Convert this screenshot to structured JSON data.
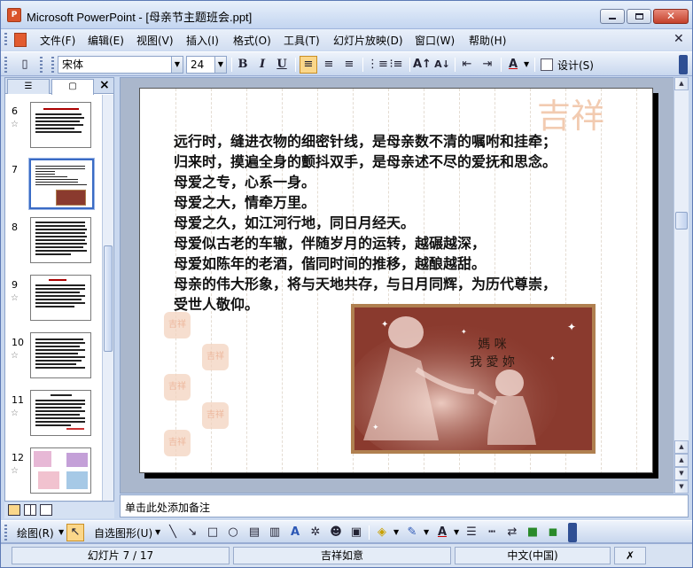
{
  "window": {
    "title": "Microsoft PowerPoint - [母亲节主题班会.ppt]",
    "app_icon": "P"
  },
  "menu": {
    "items": [
      "文件(F)",
      "编辑(E)",
      "视图(V)",
      "插入(I)",
      "格式(O)",
      "工具(T)",
      "幻灯片放映(D)",
      "窗口(W)",
      "帮助(H)"
    ]
  },
  "toolbar": {
    "font_name": "宋体",
    "font_size": "24",
    "bold": "B",
    "italic": "I",
    "underline": "U",
    "design_label": "设计(S)"
  },
  "slides_pane": {
    "tab_outline_icon": "outline-icon",
    "tab_slides_icon": "slides-icon",
    "close": "×",
    "thumbnails": [
      {
        "number": "6"
      },
      {
        "number": "7",
        "selected": true
      },
      {
        "number": "8"
      },
      {
        "number": "9"
      },
      {
        "number": "10"
      },
      {
        "number": "11"
      },
      {
        "number": "12"
      }
    ],
    "star": "☆"
  },
  "slide": {
    "lines": [
      "远行时，缝进衣物的细密针线，是母亲数不清的嘱咐和挂牵；",
      "归来时，摸遍全身的颤抖双手，是母亲述不尽的爱抚和思念。",
      "母爱之专，心系一身。",
      "母爱之大，情牵万里。",
      "母爱之久，如江河行地，同日月经天。",
      "母爱似古老的车辙，伴随岁月的运转，越碾越深，",
      "母爱如陈年的老酒，偕同时间的推移，越酿越甜。",
      "母亲的伟大形象，将与天地共存，与日月同辉，为历代尊崇，",
      "受世人敬仰。"
    ],
    "picture_caption_1": "媽 咪",
    "picture_caption_2": "我 愛 妳",
    "watermark": "吉祥",
    "seal_text": "吉祥"
  },
  "notes": {
    "placeholder": "单击此处添加备注"
  },
  "drawing_toolbar": {
    "draw_label": "绘图(R)",
    "autoshapes_label": "自选图形(U)"
  },
  "status": {
    "slide_position": "幻灯片 7 / 17",
    "design_name": "吉祥如意",
    "language": "中文(中国)"
  },
  "colors": {
    "accent": "#fbd78a",
    "frame": "#5d7ab5",
    "picture_bg": "#8a3a2e"
  }
}
